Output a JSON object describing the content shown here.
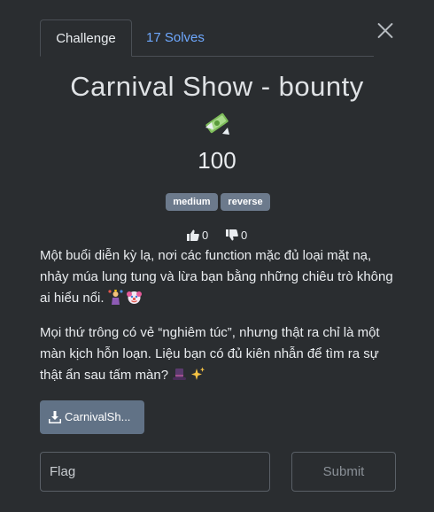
{
  "tabs": {
    "challenge_label": "Challenge",
    "solves_label": "17 Solves"
  },
  "challenge": {
    "title": "Carnival Show - bounty",
    "title_emoji": "money-with-wings-emoji",
    "value": "100",
    "tags": [
      "medium",
      "reverse"
    ],
    "likes": "0",
    "dislikes": "0",
    "description": {
      "p1": "Một buổi diễn kỳ lạ, nơi các function mặc đủ loại mặt nạ, nhảy múa lung tung và lừa bạn bằng những chiêu trò không ai hiểu nổi.",
      "p1_emojis": [
        "juggling-person-emoji",
        "clown-face-emoji"
      ],
      "p2": "Mọi thứ trông có vẻ “nghiêm túc”, nhưng thật ra chỉ là một màn kịch hỗn loạn. Liệu bạn có đủ kiên nhẫn để tìm ra sự thật ẩn sau tấm màn?",
      "p2_emojis": [
        "top-hat-emoji",
        "sparkles-emoji"
      ]
    },
    "file_label": "CarnivalSh..."
  },
  "form": {
    "flag_placeholder": "Flag",
    "submit_label": "Submit"
  },
  "colors": {
    "background": "#2a2d30",
    "accent_link": "#6ea8fe",
    "tag_bg": "#6c7a8c",
    "download_bg": "#617286"
  }
}
